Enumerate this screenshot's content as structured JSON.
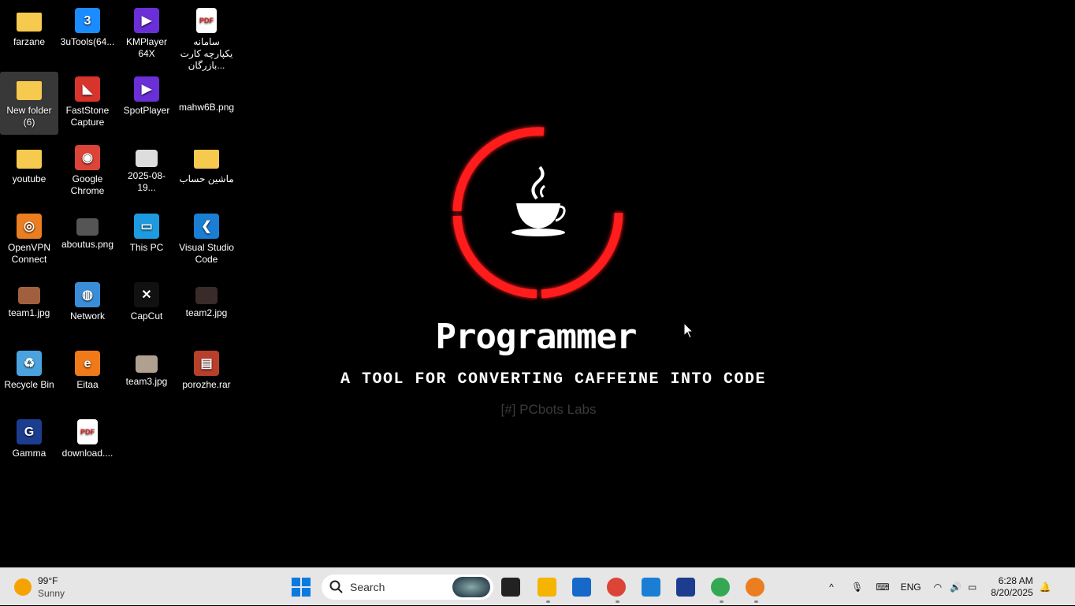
{
  "desktop_icons": [
    {
      "label": "farzane",
      "type": "folder",
      "color": "#f6c94f"
    },
    {
      "label": "3uTools(64...",
      "type": "app",
      "color": "#1a8cff",
      "glyph": "3"
    },
    {
      "label": "KMPlayer 64X",
      "type": "app",
      "color": "#6a2fd6",
      "glyph": "▶"
    },
    {
      "label": "سامانه یکپارچه کارت بازرگان...",
      "type": "pdf",
      "color": "#ffffff",
      "glyph": "PDF"
    },
    {
      "label": "New folder (6)",
      "type": "folder",
      "color": "#f6c94f",
      "selected": true
    },
    {
      "label": "FastStone Capture",
      "type": "app",
      "color": "#d9342b",
      "glyph": "◣"
    },
    {
      "label": "SpotPlayer",
      "type": "app",
      "color": "#6a2fd6",
      "glyph": "▶"
    },
    {
      "label": "mahw6B.png",
      "type": "image",
      "color": "#000000",
      "glyph": ""
    },
    {
      "label": "youtube",
      "type": "folder",
      "color": "#f6c94f"
    },
    {
      "label": "Google Chrome",
      "type": "app",
      "color": "#db4437",
      "glyph": "◉"
    },
    {
      "label": "2025-08-19...",
      "type": "image",
      "color": "#dddddd",
      "glyph": ""
    },
    {
      "label": "ماشین حساب",
      "type": "folder",
      "color": "#f6c94f"
    },
    {
      "label": "OpenVPN Connect",
      "type": "app",
      "color": "#ea7e20",
      "glyph": "◎"
    },
    {
      "label": "aboutus.png",
      "type": "image",
      "color": "#555555",
      "glyph": ""
    },
    {
      "label": "This PC",
      "type": "app",
      "color": "#1e9be0",
      "glyph": "▭"
    },
    {
      "label": "Visual Studio Code",
      "type": "app",
      "color": "#1a7fd4",
      "glyph": "❮"
    },
    {
      "label": "team1.jpg",
      "type": "image",
      "color": "#a0603f",
      "glyph": ""
    },
    {
      "label": "Network",
      "type": "app",
      "color": "#3a8ed8",
      "glyph": "◍"
    },
    {
      "label": "CapCut",
      "type": "app",
      "color": "#111111",
      "glyph": "✕"
    },
    {
      "label": "team2.jpg",
      "type": "image",
      "color": "#3a2a2a",
      "glyph": ""
    },
    {
      "label": "Recycle Bin",
      "type": "app",
      "color": "#4aa3df",
      "glyph": "♻"
    },
    {
      "label": "Eitaa",
      "type": "app",
      "color": "#f07a1a",
      "glyph": "e"
    },
    {
      "label": "team3.jpg",
      "type": "image",
      "color": "#b0a090",
      "glyph": ""
    },
    {
      "label": "porozhe.rar",
      "type": "app",
      "color": "#b8402a",
      "glyph": "▤"
    },
    {
      "label": "Gamma",
      "type": "app",
      "color": "#1c3d8f",
      "glyph": "G"
    },
    {
      "label": "download....",
      "type": "pdf",
      "color": "#ffffff",
      "glyph": "PDF"
    }
  ],
  "wallpaper": {
    "title": "Programmer",
    "tagline": "A TOOL FOR CONVERTING CAFFEINE INTO CODE",
    "brand": "[#] PCbots Labs",
    "ring_color": "#ff1a1a"
  },
  "taskbar": {
    "weather": {
      "temp": "99°F",
      "condition": "Sunny"
    },
    "search_placeholder": "Search",
    "apps": [
      {
        "name": "task-view",
        "color": "#222222"
      },
      {
        "name": "file-explorer",
        "color": "#f4b400"
      },
      {
        "name": "microsoft-store",
        "color": "#1668c9"
      },
      {
        "name": "chrome",
        "color": "#db4437"
      },
      {
        "name": "vscode",
        "color": "#1a7fd4"
      },
      {
        "name": "gamma",
        "color": "#1c3d8f"
      },
      {
        "name": "chrome-profile",
        "color": "#34a853"
      },
      {
        "name": "openvpn",
        "color": "#ea7e20"
      }
    ],
    "tray": {
      "language": "ENG",
      "time": "6:28 AM",
      "date": "8/20/2025"
    }
  }
}
